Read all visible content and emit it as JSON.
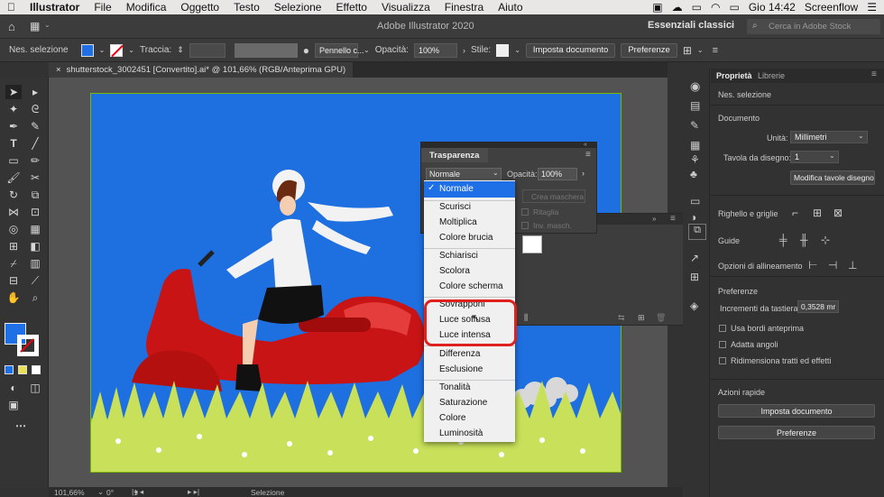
{
  "menubar": {
    "apple": "",
    "app": "Illustrator",
    "items": [
      "File",
      "Modifica",
      "Oggetto",
      "Testo",
      "Selezione",
      "Effetto",
      "Visualizza",
      "Finestra",
      "Aiuto"
    ],
    "time": "Gio 14:42",
    "screenflow": "Screenflow"
  },
  "titlebar": {
    "title": "Adobe Illustrator 2020",
    "workspace": "Essenziali classici",
    "search_placeholder": "Cerca in Adobe Stock"
  },
  "control": {
    "no_selection": "Nes. selezione",
    "stroke_label": "Traccia:",
    "brush": "Pennello c...",
    "opacity_label": "Opacità:",
    "opacity_value": "100%",
    "style_label": "Stile:",
    "doc_setup": "Imposta documento",
    "preferences": "Preferenze"
  },
  "tab": {
    "title": "shutterstock_3002451 [Convertito].ai* @ 101,66% (RGB/Anteprima GPU)",
    "close": "×"
  },
  "transparency": {
    "title": "Trasparenza",
    "mode": "Normale",
    "opacity_label": "Opacità:",
    "opacity_value": "100%",
    "make_mask": "Crea maschera",
    "clip": "Ritaglia",
    "invert": "Inv. masch."
  },
  "blend_modes": {
    "selected": "Normale",
    "groups": [
      [
        "Scurisci",
        "Moltiplica",
        "Colore brucia"
      ],
      [
        "Schiarisci",
        "Scolora",
        "Colore scherma"
      ],
      [
        "Sovrapponi",
        "Luce soffusa",
        "Luce intensa"
      ],
      [
        "Differenza",
        "Esclusione"
      ],
      [
        "Tonalità",
        "Saturazione",
        "Colore",
        "Luminosità"
      ]
    ]
  },
  "props": {
    "tab_props": "Proprietà",
    "tab_libraries": "Librerie",
    "no_selection": "Nes. selezione",
    "document": "Documento",
    "units_label": "Unità:",
    "units_value": "Millimetri",
    "artboard_label": "Tavola da disegno:",
    "artboard_value": "1",
    "edit_artboards": "Modifica tavole disegno",
    "rulers": "Righello e griglie",
    "guides": "Guide",
    "align_options": "Opzioni di allineamento",
    "preferences": "Preferenze",
    "keyboard_inc_label": "Incrementi da tastiera:",
    "keyboard_inc_value": "0,3528 mr",
    "use_preview": "Usa bordi anteprima",
    "scale_corners": "Adatta angoli",
    "scale_strokes": "Ridimensiona tratti ed effetti",
    "quick_actions": "Azioni rapide",
    "qa_doc_setup": "Imposta documento",
    "qa_prefs": "Preferenze"
  },
  "status": {
    "zoom": "101,66%",
    "angle": "0°",
    "artboard": "1",
    "mode": "Selezione"
  },
  "colors": {
    "accent": "#1f6fe6",
    "highlight": "#e0201c",
    "artboard": "#1e6fe0",
    "scooter": "#c81414"
  }
}
